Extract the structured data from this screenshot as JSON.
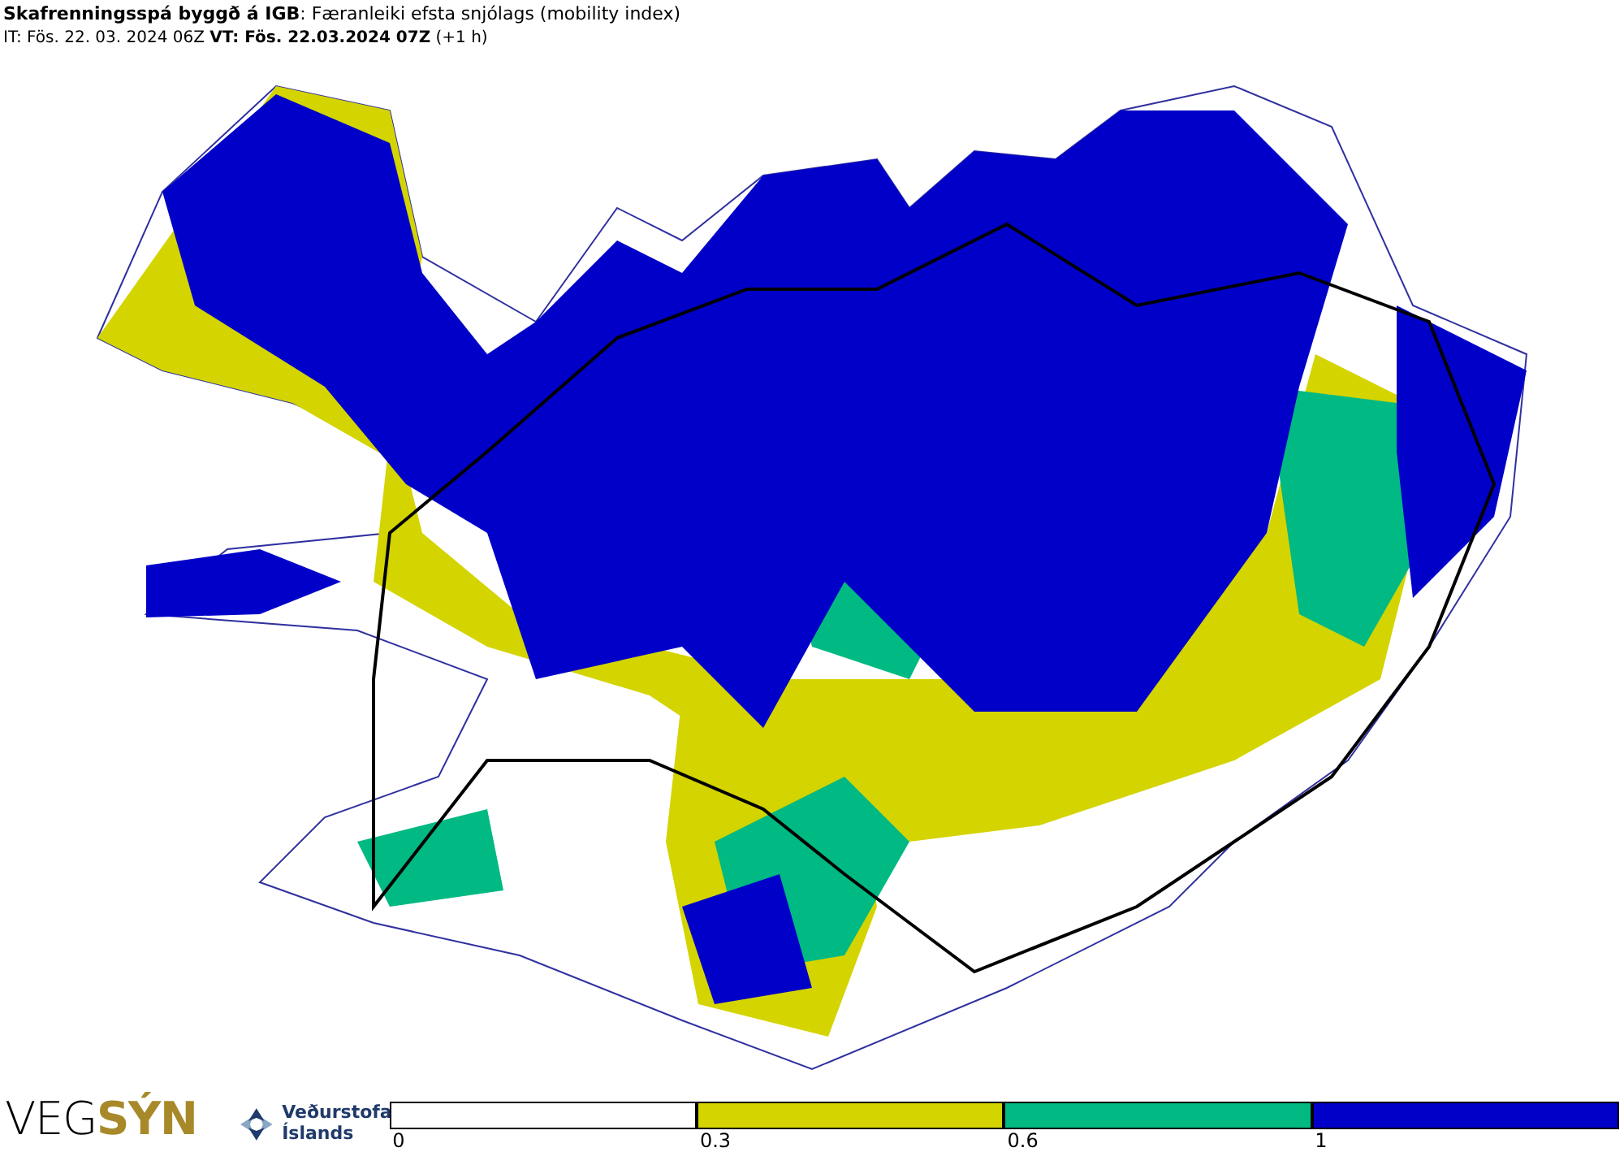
{
  "header": {
    "title": "**Skafrenningsspá byggð á IGB**: Færanleiki efsta snjólags (mobility index)",
    "times": "IT: Fös. 22. 03. 2024 06Z **VT: Fös. 22.03.2024 07Z** (+1 h)"
  },
  "logos": {
    "vegsyn": [
      "VEG",
      "SÝN"
    ],
    "vedurstofa": [
      "Veðurstofa",
      "Íslands"
    ]
  },
  "legend": [
    {
      "color": "#ffffff",
      "label": "0"
    },
    {
      "color": "#d4d400",
      "label": "0.3"
    },
    {
      "color": "#00b983",
      "label": "0.6"
    },
    {
      "color": "#0000c8",
      "label": "1"
    }
  ]
}
